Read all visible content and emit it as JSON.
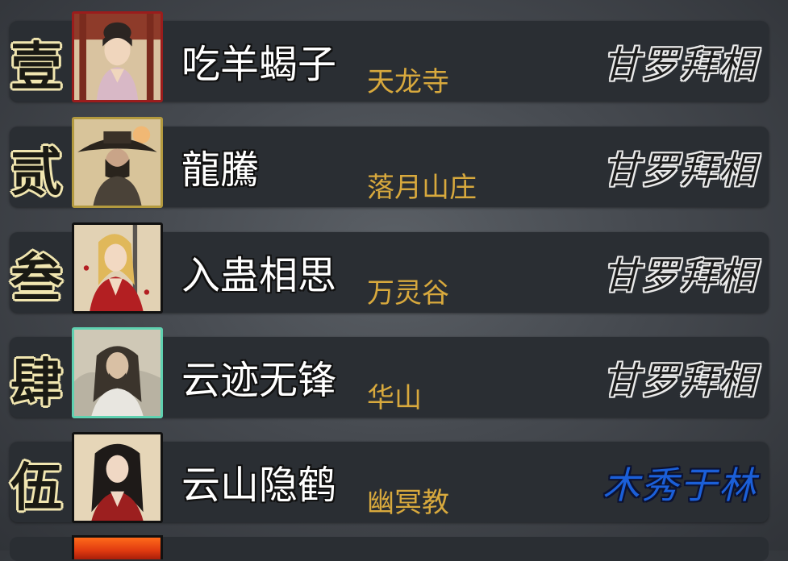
{
  "leaderboard": {
    "rows": [
      {
        "rank": "壹",
        "name": "吃羊蝎子",
        "sect": "天龙寺",
        "title": "甘罗拜相",
        "title_color": "#eaeaea",
        "avatar": "portrait-woman-hair-bun",
        "frame": "frame-red"
      },
      {
        "rank": "贰",
        "name": "龍騰",
        "sect": "落月山庄",
        "title": "甘罗拜相",
        "title_color": "#eaeaea",
        "avatar": "portrait-man-straw-hat",
        "frame": "frame-gold"
      },
      {
        "rank": "叁",
        "name": "入蛊相思",
        "sect": "万灵谷",
        "title": "甘罗拜相",
        "title_color": "#eaeaea",
        "avatar": "portrait-woman-blonde-sword",
        "frame": "frame-dark"
      },
      {
        "rank": "肆",
        "name": "云迹无锋",
        "sect": "华山",
        "title": "甘罗拜相",
        "title_color": "#eaeaea",
        "avatar": "portrait-man-long-hair",
        "frame": "frame-teal"
      },
      {
        "rank": "伍",
        "name": "云山隐鹤",
        "sect": "幽冥教",
        "title": "木秀于林",
        "title_color": "#1b5fd8",
        "avatar": "portrait-man-black-hair-red-robe",
        "frame": "frame-dark"
      }
    ]
  }
}
